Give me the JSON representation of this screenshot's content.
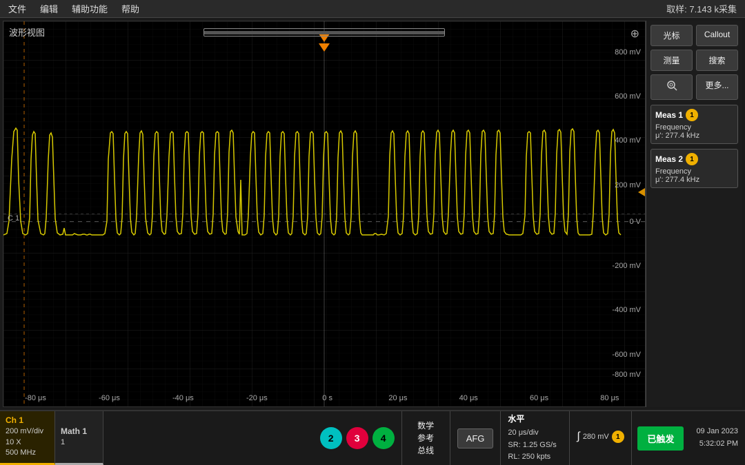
{
  "menu": {
    "items": [
      "文件",
      "编辑",
      "辅助功能",
      "帮助"
    ],
    "sample_info": "取样: 7.143 k采集"
  },
  "waveform": {
    "label": "波形视图",
    "time_labels": [
      "-80 μs",
      "-60 μs",
      "-40 μs",
      "-20 μs",
      "0 s",
      "20 μs",
      "40 μs",
      "60 μs",
      "80 μs"
    ],
    "voltage_labels": [
      "800 mV",
      "600 mV",
      "400 mV",
      "200 mV",
      "0 V",
      "-200 mV",
      "-400 mV",
      "-600 mV",
      "-800 mV"
    ],
    "c1_label": "C 1",
    "cursor_label": "光标",
    "callout_label": "Callout",
    "measure_label": "测量",
    "search_label": "搜索",
    "zoom_label": "⊕",
    "more_label": "更多..."
  },
  "meas1": {
    "title": "Meas 1",
    "dot_num": "1",
    "param": "Frequency",
    "value": "μ': 277.4 kHz"
  },
  "meas2": {
    "title": "Meas 2",
    "dot_num": "1",
    "param": "Frequency",
    "value": "μ': 277.4 kHz"
  },
  "ch1": {
    "label": "Ch 1",
    "div": "200 mV/div",
    "probe": "10 X",
    "bandwidth": "500 MHz"
  },
  "math1": {
    "label": "Math 1",
    "value": "1"
  },
  "channels": {
    "ch2_label": "2",
    "ch3_label": "3",
    "ch4_label": "4"
  },
  "bottom": {
    "math_ref_bus": "数学\n参考\n总线",
    "afg_label": "AFG",
    "horizontal_title": "水平",
    "horizontal_div": "20 μs/div",
    "horizontal_sr": "SR: 1.25 GS/s",
    "horizontal_rl": "RL: 250 kpts",
    "trigger_symbol": "∫",
    "trigger_value": "280 mV",
    "triggered_label": "已触发",
    "trig_ch_num": "1",
    "date": "09 Jan 2023",
    "time": "5:32:02 PM"
  }
}
